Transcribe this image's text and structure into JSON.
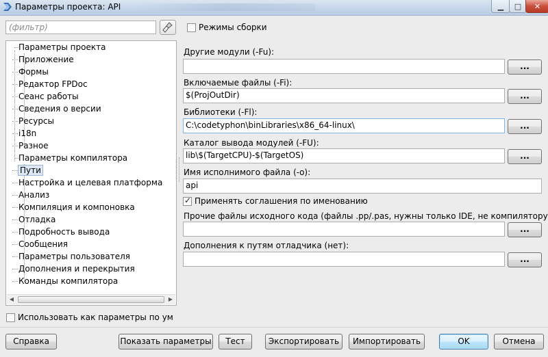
{
  "window": {
    "title": "Параметры проекта: API",
    "app_icon": "lazarus-icon",
    "controls": {
      "minimize": "minimize-icon",
      "maximize": "maximize-icon",
      "close": "close-icon"
    }
  },
  "filter": {
    "placeholder": "(фильтр)",
    "clear_icon": "broom-icon"
  },
  "tree": {
    "groups": [
      {
        "label": "Параметры проекта",
        "items": [
          "Приложение",
          "Формы",
          "Редактор FPDoc",
          "Сеанс работы",
          "Сведения о версии",
          "Ресурсы",
          "i18n",
          "Разное"
        ]
      },
      {
        "label": "Параметры компилятора",
        "items": [
          "Пути",
          "Настройка и целевая платформа",
          "Анализ",
          "Компиляция и компоновка",
          "Отладка",
          "Подробность вывода",
          "Сообщения",
          "Параметры пользователя",
          "Дополнения и перекрытия",
          "Команды компилятора"
        ]
      }
    ],
    "selected": "Пути"
  },
  "build_modes": {
    "label": "Режимы сборки",
    "checked": false
  },
  "paths": {
    "other_units_label": "Другие модули (-Fu):",
    "other_units_value": "",
    "include_files_label": "Включаемые файлы (-Fi):",
    "include_files_value": "$(ProjOutDir)",
    "libraries_label": "Библиотеки (-Fl):",
    "libraries_value": "C:\\codetyphon\\binLibraries\\x86_64-linux\\",
    "unit_output_label": "Каталог вывода модулей (-FU):",
    "unit_output_value": "lib\\$(TargetCPU)-$(TargetOS)",
    "target_file_label": "Имя исполнимого файла (-o):",
    "target_file_value": "api",
    "naming_conventions_label": "Применять соглашения по именованию",
    "naming_conventions_checked": true,
    "other_sources_label": "Прочие файлы исходного кода (файлы .pp/.pas, нужны только IDE, не компилятору)",
    "other_sources_value": "",
    "debugger_paths_label": "Дополнения к путям отладчика (нет):",
    "debugger_paths_value": "",
    "browse_label": "..."
  },
  "use_as_default": {
    "label": "Использовать как параметры по умолчанию",
    "checked": false
  },
  "buttons": {
    "help": "Справка",
    "show_options": "Показать параметры",
    "test": "Тест",
    "export": "Экспортировать",
    "import": "Импортировать",
    "ok": "OK",
    "cancel": "Отмена"
  }
}
